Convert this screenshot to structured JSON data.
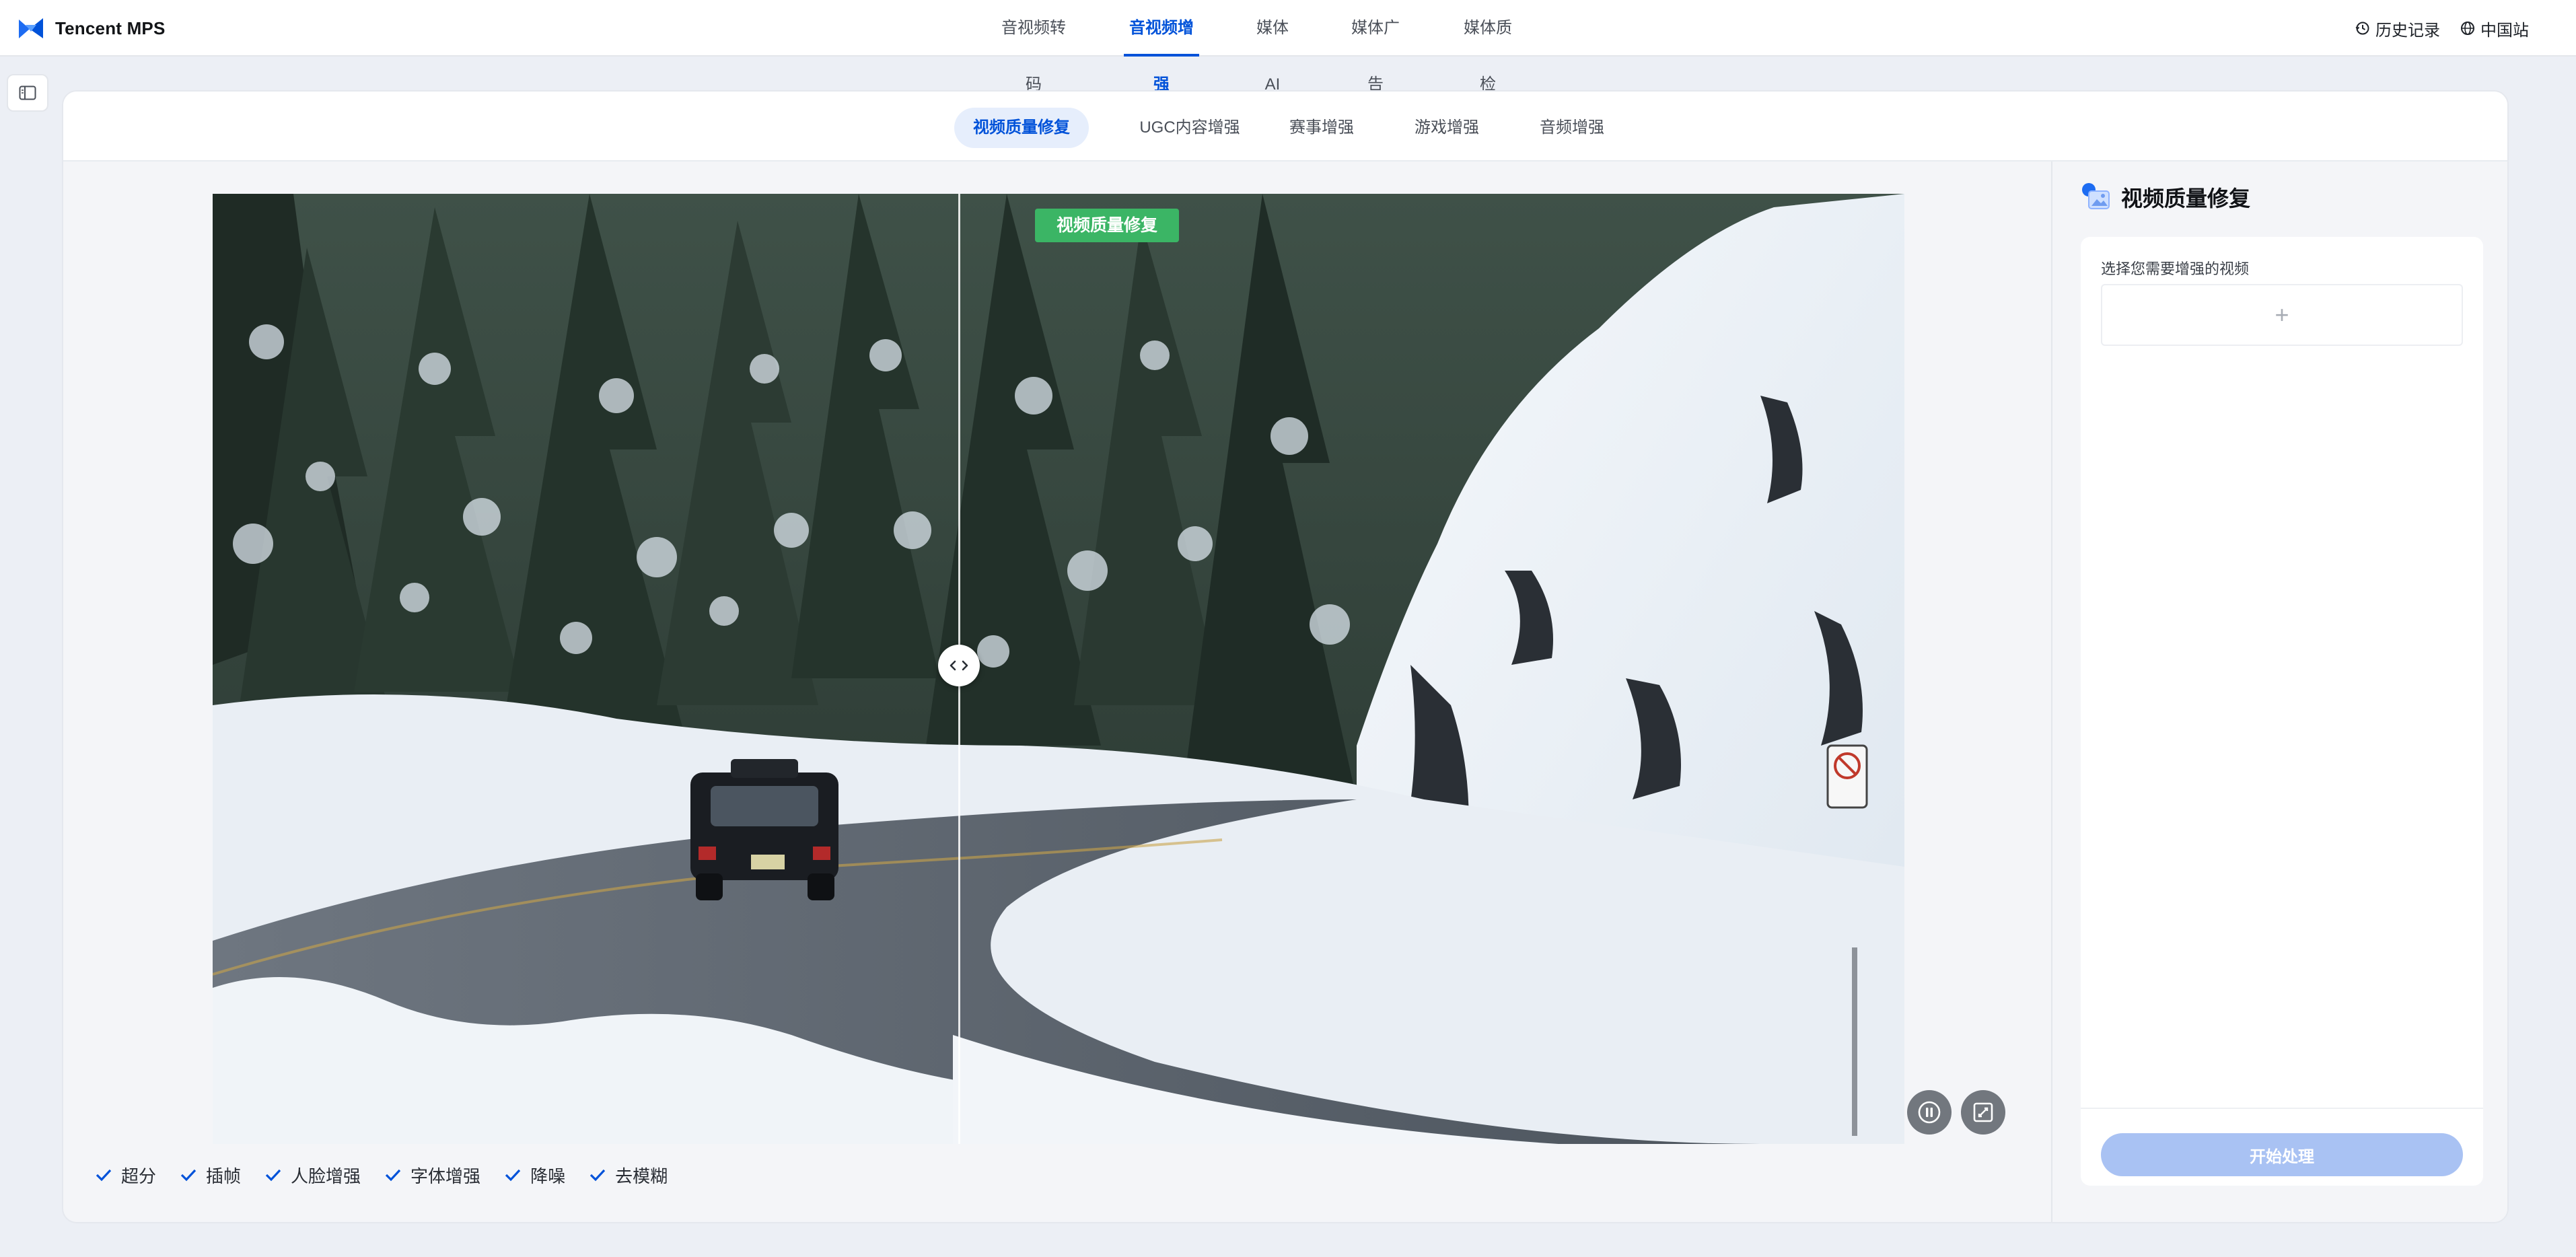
{
  "brand": {
    "name": "Tencent MPS",
    "icon": "mps-logo-icon"
  },
  "topnav": {
    "items": [
      {
        "label": "音视频转码",
        "active": false
      },
      {
        "label": "音视频增强",
        "active": true
      },
      {
        "label": "媒体AI",
        "active": false
      },
      {
        "label": "媒体广告",
        "active": false
      },
      {
        "label": "媒体质检",
        "active": false
      }
    ]
  },
  "top_right": {
    "history": "历史记录",
    "region": "中国站"
  },
  "subtabs": [
    {
      "label": "视频质量修复",
      "active": true
    },
    {
      "label": "UGC内容增强",
      "active": false
    },
    {
      "label": "赛事增强",
      "active": false
    },
    {
      "label": "游戏增强",
      "active": false
    },
    {
      "label": "音频增强",
      "active": false
    }
  ],
  "viewer": {
    "badge": "视频质量修复",
    "split_position": 0.44
  },
  "features": [
    "超分",
    "插帧",
    "人脸增强",
    "字体增强",
    "降噪",
    "去模糊"
  ],
  "panel": {
    "title": "视频质量修复",
    "select_label": "选择您需要增强的视频",
    "upload_symbol": "+",
    "start_button": "开始处理"
  },
  "colors": {
    "accent": "#0052d9",
    "badge": "#3bb565",
    "disabled_button": "#a9c2f3"
  }
}
